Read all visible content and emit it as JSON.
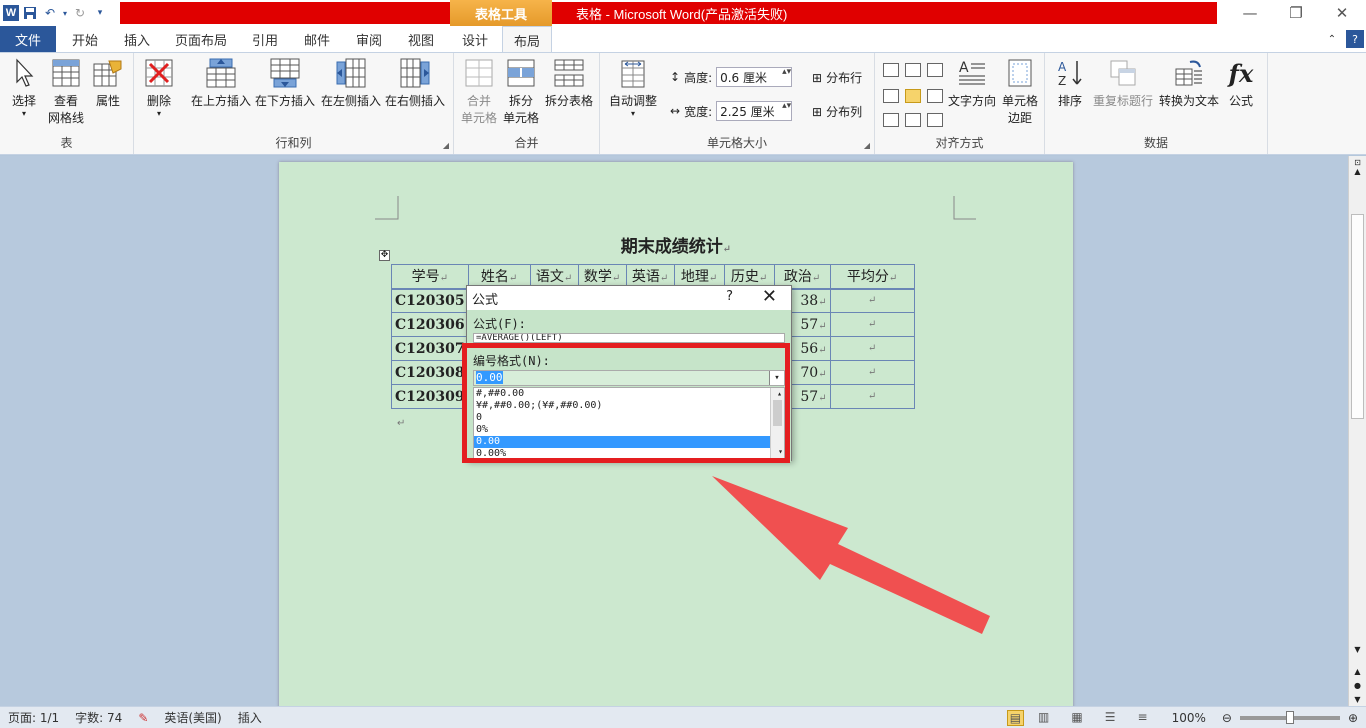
{
  "window": {
    "title": "表格 - Microsoft Word(产品激活失败)",
    "context_tab_title": "表格工具",
    "word_icon_glyph": "W"
  },
  "tabs": [
    {
      "label": "文件"
    },
    {
      "label": "开始"
    },
    {
      "label": "插入"
    },
    {
      "label": "页面布局"
    },
    {
      "label": "引用"
    },
    {
      "label": "邮件"
    },
    {
      "label": "审阅"
    },
    {
      "label": "视图"
    },
    {
      "label": "设计"
    },
    {
      "label": "布局"
    }
  ],
  "ribbon": {
    "groups": {
      "table": "表",
      "rows_cols": "行和列",
      "merge": "合并",
      "cell_size": "单元格大小",
      "alignment": "对齐方式",
      "data": "数据"
    },
    "buttons": {
      "select": "选择",
      "gridlines_1": "查看",
      "gridlines_2": "网格线",
      "properties": "属性",
      "delete": "删除",
      "insert_above": "在上方插入",
      "insert_below": "在下方插入",
      "insert_left": "在左侧插入",
      "insert_right": "在右侧插入",
      "merge_cells_1": "合并",
      "merge_cells_2": "单元格",
      "split_cells_1": "拆分",
      "split_cells_2": "单元格",
      "split_table": "拆分表格",
      "autofit": "自动调整",
      "height_label": "高度:",
      "height_value": "0.6 厘米",
      "width_label": "宽度:",
      "width_value": "2.25 厘米",
      "distribute_rows": "分布行",
      "distribute_cols": "分布列",
      "text_direction": "文字方向",
      "cell_margins_1": "单元格",
      "cell_margins_2": "边距",
      "sort": "排序",
      "repeat_header": "重复标题行",
      "convert_to_text": "转换为文本",
      "formula": "公式"
    }
  },
  "document": {
    "title": "期末成绩统计",
    "headers": [
      "学号",
      "姓名",
      "语文",
      "数学",
      "英语",
      "地理",
      "历史",
      "政治",
      "平均分"
    ],
    "rows": [
      {
        "id": "C120305",
        "last": "38"
      },
      {
        "id": "C120306",
        "last": "57"
      },
      {
        "id": "C120307",
        "last": "56"
      },
      {
        "id": "C120308",
        "last": "70"
      },
      {
        "id": "C120309",
        "last": "57"
      }
    ],
    "paragraph_mark": "↵"
  },
  "dialog": {
    "title": "公式",
    "help": "?",
    "close": "✕",
    "formula_label": "公式(F):",
    "formula_value": "=AVERAGE()(LEFT)",
    "number_format_label": "编号格式(N):",
    "number_format_value": "0.00",
    "options": [
      "#,##0.00",
      "¥#,##0.00;(¥#,##0.00)",
      "0",
      "0%",
      "0.00",
      "0.00%"
    ],
    "selected_index": 4
  },
  "status": {
    "page": "页面: 1/1",
    "words": "字数: 74",
    "language": "英语(美国)",
    "mode": "插入",
    "zoom": "100%"
  },
  "colors": {
    "ribbon_file": "#2b579a",
    "title_red": "#e00000",
    "context_orange": "#f0a636",
    "page_green": "#cce8cf",
    "highlight_box": "#e41e20",
    "arrow": "#f05050"
  }
}
